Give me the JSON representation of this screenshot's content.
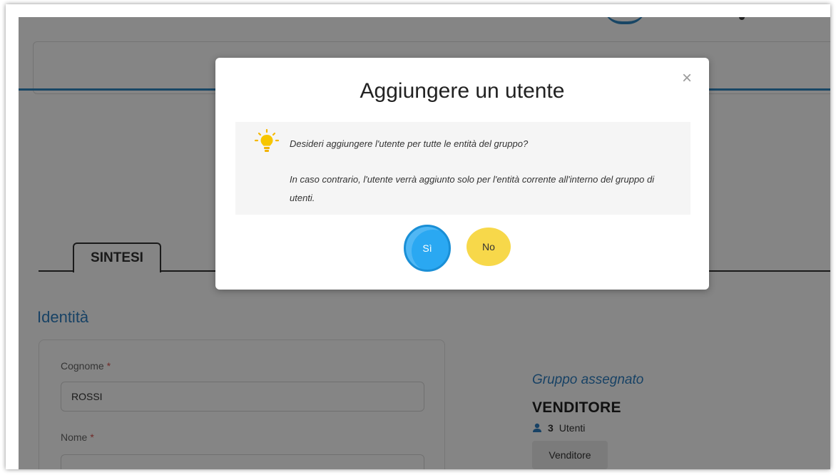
{
  "page": {
    "tab_label": "SINTESI",
    "section_title": "Identità",
    "fields": [
      {
        "label": "Cognome",
        "required_mark": "*",
        "value": "ROSSI"
      },
      {
        "label": "Nome",
        "required_mark": "*",
        "value": ""
      }
    ],
    "group": {
      "heading": "Gruppo assegnato",
      "name": "VENDITORE",
      "user_count": "3",
      "users_label": "Utenti",
      "chip": "Venditore"
    }
  },
  "modal": {
    "title": "Aggiungere un utente",
    "close_glyph": "×",
    "message_1": "Desideri aggiungere l'utente per tutte le entità del gruppo?",
    "message_2": "In caso contrario, l'utente verrà aggiunto solo per l'entità corrente all'interno del gruppo di utenti.",
    "yes_label": "Sì",
    "no_label": "No"
  },
  "colors": {
    "accent_blue": "#2e7fc1",
    "yes_button": "#2aa8f2",
    "no_button": "#f7d84a",
    "required": "#d9534f"
  },
  "icons": {
    "notice": "lightbulb-icon",
    "users": "user-icon",
    "close": "close-icon"
  }
}
